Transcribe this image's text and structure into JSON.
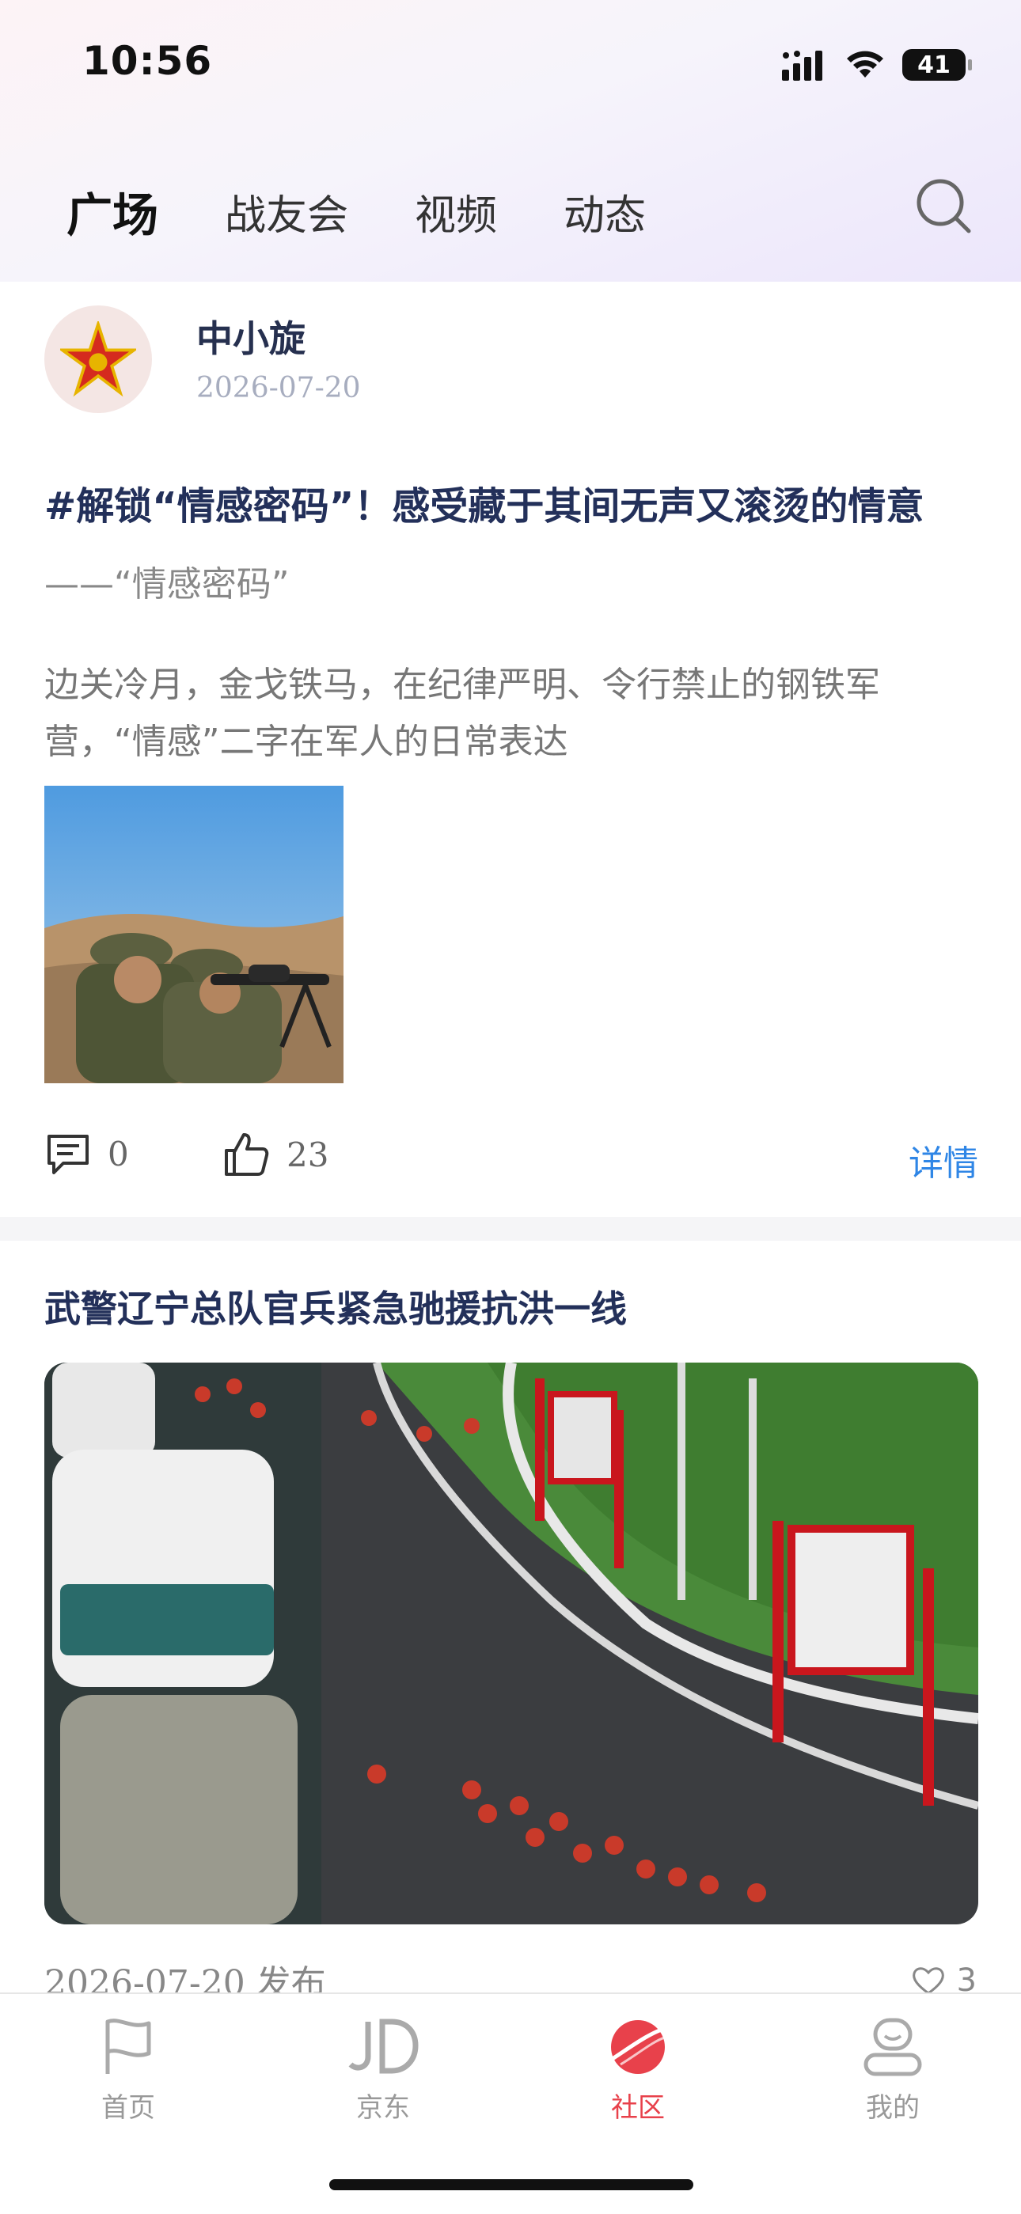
{
  "status_bar": {
    "time": "10:56",
    "battery": "41"
  },
  "tabs": [
    {
      "label": "广场",
      "active": true
    },
    {
      "label": "战友会",
      "active": false
    },
    {
      "label": "视频",
      "active": false
    },
    {
      "label": "动态",
      "active": false
    }
  ],
  "post1": {
    "author": "中小旋",
    "date": "2026-07-20",
    "title": "#解锁“情感密码”！感受藏于其间无声又滚烫的情意",
    "quote": "——“情感密码”",
    "excerpt": "边关冷月，金戈铁马，在纪律严明、令行禁止的钢铁军营，“情感”二字在军人的日常表达",
    "comments": "0",
    "likes": "23",
    "detail_label": "详情"
  },
  "post2": {
    "title": "武警辽宁总队官兵紧急驰援抗洪一线",
    "meta": "2026-07-20 发布",
    "likes": "3"
  },
  "bottom_nav": [
    {
      "label": "首页",
      "icon": "flag-icon"
    },
    {
      "label": "京东",
      "icon": "jd-icon"
    },
    {
      "label": "社区",
      "icon": "planet-icon",
      "active": true
    },
    {
      "label": "我的",
      "icon": "profile-icon"
    }
  ],
  "colors": {
    "accent_blue": "#2f86e6",
    "active_red": "#e8414b",
    "title_navy": "#23305a"
  }
}
